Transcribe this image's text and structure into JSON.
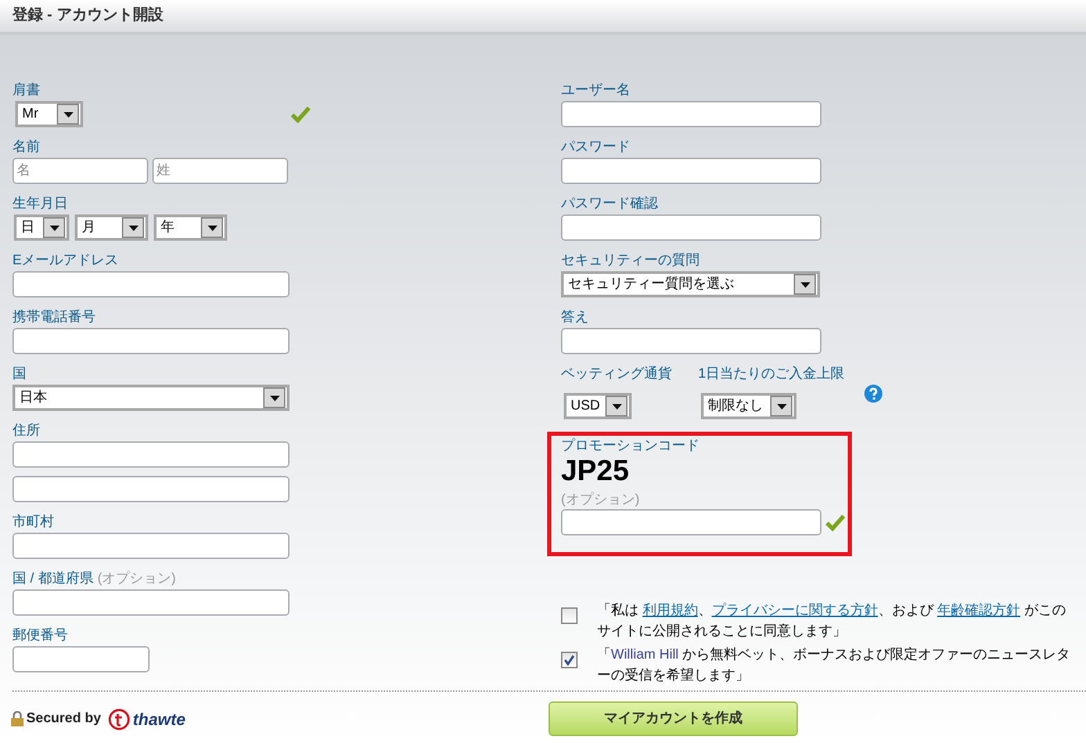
{
  "header": {
    "title": "登録 - アカウント開設"
  },
  "left_fields": [
    {
      "kind": "select",
      "label": "肩書",
      "value": "Mr",
      "valid": true
    },
    {
      "kind": "pair",
      "label": "名前",
      "placeholders": [
        "名",
        "姓"
      ]
    },
    {
      "kind": "dates",
      "label": "生年月日",
      "values": [
        "日",
        "月",
        "年"
      ]
    },
    {
      "kind": "text",
      "label": "Eメールアドレス"
    },
    {
      "kind": "text",
      "label": "携帯電話番号"
    },
    {
      "kind": "wide-select",
      "label": "国",
      "value": "日本"
    },
    {
      "kind": "double",
      "label": "住所"
    },
    {
      "kind": "text",
      "label": "市町村"
    },
    {
      "kind": "text",
      "label": "国 / 都道府県",
      "note": "(オプション)"
    },
    {
      "kind": "short",
      "label": "郵便番号"
    }
  ],
  "right_fields": [
    {
      "kind": "text",
      "label": "ユーザー名"
    },
    {
      "kind": "text",
      "label": "パスワード"
    },
    {
      "kind": "text",
      "label": "パスワード確認"
    },
    {
      "kind": "wide-select",
      "label": "セキュリティーの質問",
      "value": "セキュリティー質問を選ぶ"
    },
    {
      "kind": "text",
      "label": "答え"
    }
  ],
  "limits": [
    {
      "label": "ベッティング通貨",
      "value": "USD"
    },
    {
      "label": "1日当たりのご入金上限",
      "value": "制限なし"
    }
  ],
  "promo": {
    "label": "プロモーションコード",
    "code": "JP25",
    "note": "(オプション)",
    "valid": true
  },
  "consents": [
    {
      "checked": false,
      "parts": [
        {
          "kind": "text",
          "text": "「私は "
        },
        {
          "kind": "link",
          "text": "利用規約"
        },
        {
          "kind": "text",
          "text": "、"
        },
        {
          "kind": "link",
          "text": "プライバシーに関する方針"
        },
        {
          "kind": "text",
          "text": "、および "
        },
        {
          "kind": "link",
          "text": "年齢確認方針"
        },
        {
          "kind": "text",
          "text": " がこのサイトに公開されることに同意します」"
        }
      ]
    },
    {
      "checked": true,
      "parts": [
        {
          "kind": "text",
          "text": "「"
        },
        {
          "kind": "brand",
          "text": "William Hill"
        },
        {
          "kind": "text",
          "text": " から無料ベット、ボーナスおよび限定オファーのニュースレターの受信を希望します」"
        }
      ]
    }
  ],
  "footer": {
    "secured": "Secured by",
    "brand": "thawte",
    "button": "マイアカウントを作成"
  }
}
